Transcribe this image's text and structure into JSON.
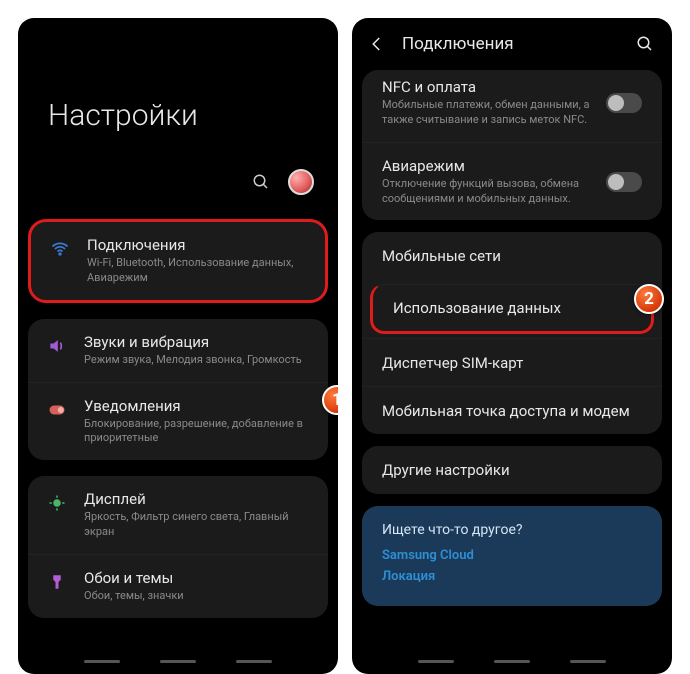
{
  "left": {
    "hero_title": "Настройки",
    "items": [
      {
        "icon": "wifi",
        "color": "#3a7bd5",
        "title": "Подключения",
        "sub": "Wi-Fi, Bluetooth, Использование данных, Авиарежим",
        "hl": true
      },
      {
        "icon": "sound",
        "color": "#a05bd5",
        "title": "Звуки и вибрация",
        "sub": "Режим звука, Мелодия звонка, Громкость"
      },
      {
        "icon": "notif",
        "color": "#d5615b",
        "title": "Уведомления",
        "sub": "Блокирование, разрешение, добавление в приоритетные"
      },
      {
        "icon": "display",
        "color": "#4ab56a",
        "title": "Дисплей",
        "sub": "Яркость, Фильтр синего света, Главный экран"
      },
      {
        "icon": "theme",
        "color": "#b55bd5",
        "title": "Обои и темы",
        "sub": "Обои, темы, значки"
      }
    ]
  },
  "right": {
    "appbar_title": "Подключения",
    "group1": [
      {
        "title": "NFC и оплата",
        "sub": "Мобильные платежи, обмен данными, а также считывание и запись меток NFC.",
        "toggle": true
      },
      {
        "title": "Авиарежим",
        "sub": "Отключение функций вызова, обмена сообщениями и мобильных данных.",
        "toggle": true
      }
    ],
    "group2": [
      {
        "title": "Мобильные сети"
      },
      {
        "title": "Использование данных",
        "hl": true
      },
      {
        "title": "Диспетчер SIM-карт"
      },
      {
        "title": "Мобильная точка доступа и модем"
      }
    ],
    "group3": [
      {
        "title": "Другие настройки"
      }
    ],
    "info": {
      "title": "Ищете что-то другое?",
      "links": [
        "Samsung Cloud",
        "Локация"
      ]
    }
  },
  "badges": {
    "b1": "1",
    "b2": "2"
  }
}
